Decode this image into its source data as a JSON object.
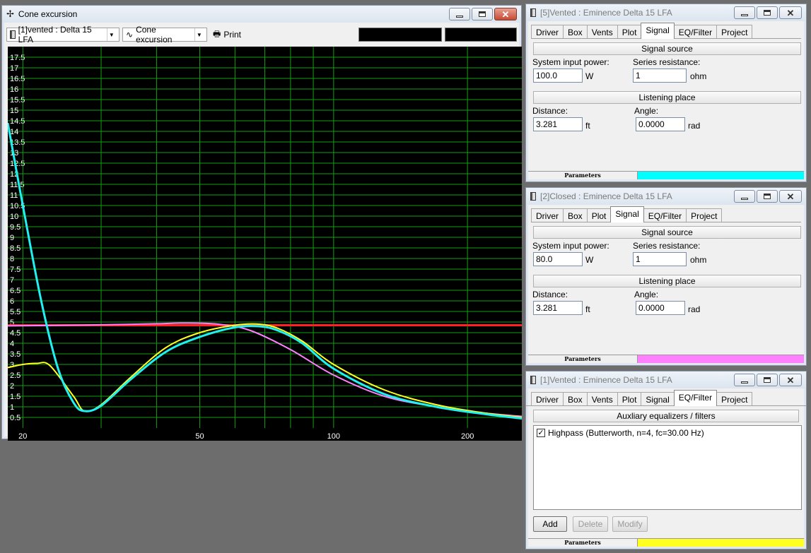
{
  "cone_window": {
    "title": "Cone excursion",
    "project_combo": "[1]vented : Delta 15 LFA",
    "view_combo": "Cone excursion",
    "print_label": "Print"
  },
  "chart_data": {
    "type": "line",
    "x_scale": "log",
    "xlim": [
      18.5,
      265
    ],
    "ylim": [
      0,
      18
    ],
    "x_tick_labels": [
      "20",
      "50",
      "100",
      "200"
    ],
    "x_tick_values": [
      20,
      50,
      100,
      200
    ],
    "y_tick_labels": [
      "0.5",
      "1",
      "1.5",
      "2",
      "2.5",
      "3",
      "3.5",
      "4",
      "4.5",
      "5",
      "5.5",
      "6",
      "6.5",
      "7",
      "7.5",
      "8",
      "8.5",
      "9",
      "9.5",
      "10",
      "10.5",
      "11",
      "11.5",
      "12",
      "12.5",
      "13",
      "13.5",
      "14",
      "14.5",
      "15",
      "15.5",
      "16",
      "16.5",
      "17",
      "17.5"
    ],
    "series": [
      {
        "color": "#ff2020",
        "x": [
          18.5,
          30,
          50,
          70,
          100,
          150,
          265
        ],
        "y": [
          4.85,
          4.85,
          4.85,
          4.85,
          4.85,
          4.85,
          4.85
        ]
      },
      {
        "color": "#ff80ff",
        "x": [
          18.5,
          25,
          30,
          40,
          46,
          55,
          65,
          80,
          100,
          130,
          170,
          220,
          265
        ],
        "y": [
          4.82,
          4.85,
          4.87,
          4.92,
          4.95,
          4.9,
          4.6,
          3.7,
          2.5,
          1.5,
          1.0,
          0.7,
          0.55
        ]
      },
      {
        "color": "#ffff20",
        "x": [
          18.5,
          20,
          21.5,
          23,
          26,
          27.5,
          30,
          35,
          42,
          50,
          60,
          68,
          75,
          85,
          100,
          130,
          170,
          220,
          265
        ],
        "y": [
          2.85,
          3.0,
          3.05,
          2.95,
          1.5,
          0.8,
          1.1,
          2.4,
          3.8,
          4.5,
          4.85,
          4.9,
          4.7,
          4.1,
          3.0,
          1.8,
          1.1,
          0.7,
          0.5
        ]
      },
      {
        "color": "#20f0f0",
        "x": [
          18.5,
          20,
          22,
          24,
          26,
          27.5,
          30,
          35,
          42,
          50,
          60,
          68,
          75,
          85,
          100,
          130,
          170,
          220,
          265
        ],
        "y": [
          14.4,
          10.5,
          6.0,
          2.8,
          1.2,
          0.8,
          1.05,
          2.3,
          3.6,
          4.3,
          4.75,
          4.8,
          4.6,
          4.0,
          2.8,
          1.6,
          1.0,
          0.65,
          0.45
        ]
      }
    ]
  },
  "panel5": {
    "title": "[5]Vented : Eminence  Delta 15 LFA",
    "tabs": [
      "Driver",
      "Box",
      "Vents",
      "Plot",
      "Signal",
      "EQ/Filter",
      "Project"
    ],
    "signal_source": "Signal source",
    "input_power_label": "System input power:",
    "input_power_value": "100.0",
    "input_power_unit": "W",
    "series_res_label": "Series resistance:",
    "series_res_value": "1",
    "series_res_unit": "ohm",
    "listening_place": "Listening place",
    "distance_label": "Distance:",
    "distance_value": "3.281",
    "distance_unit": "ft",
    "angle_label": "Angle:",
    "angle_value": "0.0000",
    "angle_unit": "rad",
    "params_label": "Parameters",
    "color": "#00ffff"
  },
  "panel2": {
    "title": "[2]Closed : Eminence  Delta 15 LFA",
    "tabs": [
      "Driver",
      "Box",
      "Plot",
      "Signal",
      "EQ/Filter",
      "Project"
    ],
    "signal_source": "Signal source",
    "input_power_label": "System input power:",
    "input_power_value": "80.0",
    "input_power_unit": "W",
    "series_res_label": "Series resistance:",
    "series_res_value": "1",
    "series_res_unit": "ohm",
    "listening_place": "Listening place",
    "distance_label": "Distance:",
    "distance_value": "3.281",
    "distance_unit": "ft",
    "angle_label": "Angle:",
    "angle_value": "0.0000",
    "angle_unit": "rad",
    "params_label": "Parameters",
    "color": "#ff80ff"
  },
  "panel1": {
    "title": "[1]Vented : Eminence  Delta 15 LFA",
    "tabs": [
      "Driver",
      "Box",
      "Vents",
      "Plot",
      "Signal",
      "EQ/Filter",
      "Project"
    ],
    "aux_label": "Auxliary equalizers / filters",
    "filter_item": "Highpass (Butterworth, n=4, fc=30.00 Hz)",
    "add_label": "Add",
    "delete_label": "Delete",
    "modify_label": "Modify",
    "params_label": "Parameters",
    "color": "#ffff20"
  }
}
